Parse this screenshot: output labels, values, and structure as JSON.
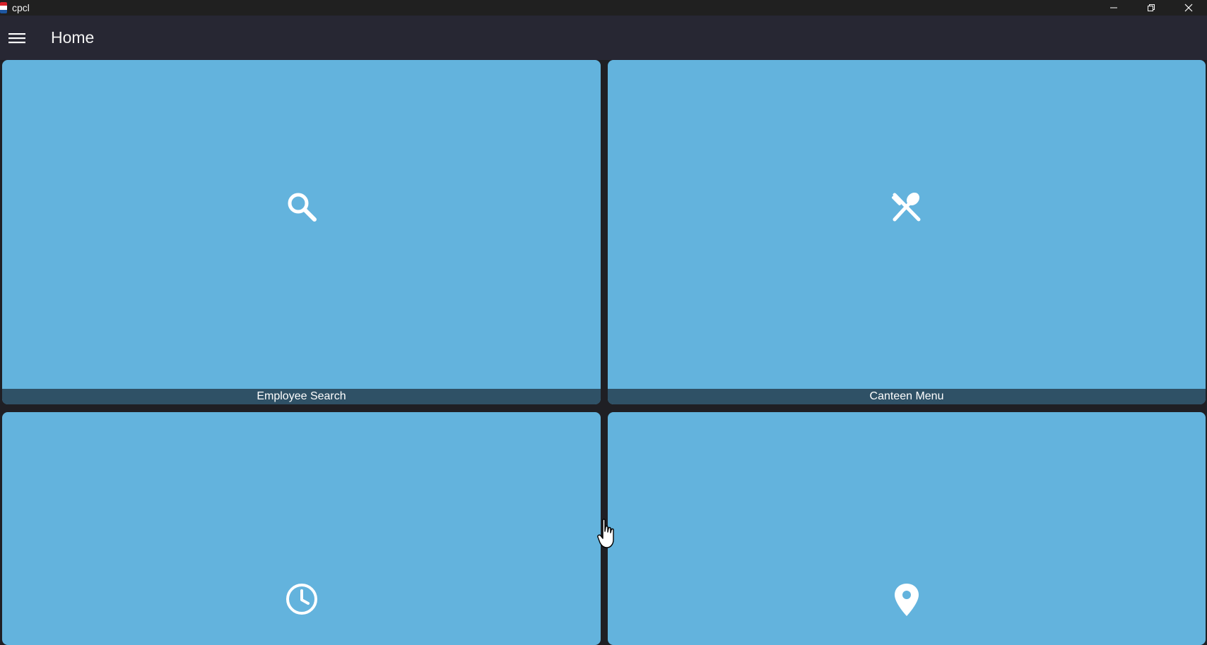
{
  "window": {
    "title": "cpcl",
    "controls": [
      "minimize-icon",
      "restore-icon",
      "close-icon"
    ]
  },
  "appbar": {
    "menu_icon": "hamburger-menu-icon",
    "title": "Home"
  },
  "tiles": [
    {
      "label": "Employee Search",
      "icon": "search-icon"
    },
    {
      "label": "Canteen Menu",
      "icon": "fork-spoon-icon"
    },
    {
      "label": "",
      "icon": "clock-icon"
    },
    {
      "label": "",
      "icon": "location-pin-icon"
    }
  ],
  "colors": {
    "tile_background": "#63b3dd",
    "tile_label_bar": "#2f5166",
    "appbar": "#272733",
    "titlebar": "#202020"
  }
}
